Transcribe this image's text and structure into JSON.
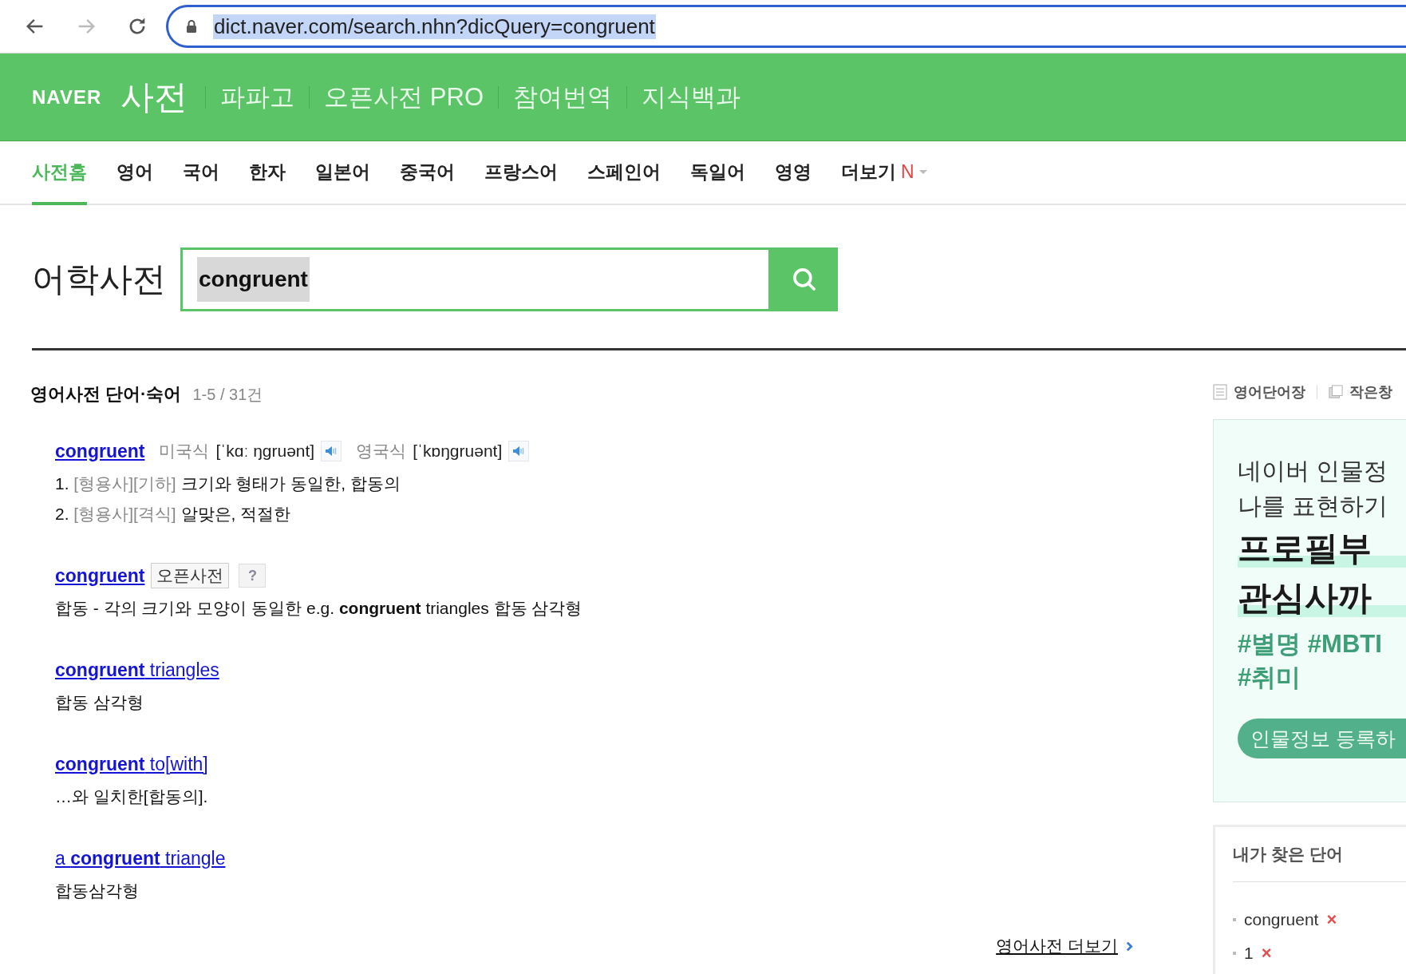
{
  "browser": {
    "url": "dict.naver.com/search.nhn?dicQuery=congruent",
    "forward_disabled": true
  },
  "header": {
    "logo": "NAVER",
    "title": "사전",
    "links": [
      "파파고",
      "오픈사전 PRO",
      "참여번역",
      "지식백과"
    ]
  },
  "tabs": [
    {
      "label": "사전홈",
      "selected": true
    },
    {
      "label": "영어",
      "selected": false
    },
    {
      "label": "국어",
      "selected": false
    },
    {
      "label": "한자",
      "selected": false
    },
    {
      "label": "일본어",
      "selected": false
    },
    {
      "label": "중국어",
      "selected": false
    },
    {
      "label": "프랑스어",
      "selected": false
    },
    {
      "label": "스페인어",
      "selected": false
    },
    {
      "label": "독일어",
      "selected": false
    },
    {
      "label": "영영",
      "selected": false
    },
    {
      "label": "더보기",
      "selected": false,
      "badge": "N"
    }
  ],
  "search": {
    "title": "어학사전",
    "value": "congruent"
  },
  "results": {
    "title": "영어사전 단어·숙어",
    "count": "1-5 / 31건",
    "entries": [
      {
        "kind": "pron",
        "headword": "congruent",
        "pronunciations": [
          {
            "label": "미국식",
            "ipa": "[ˈkɑː ŋgruənt]"
          },
          {
            "label": "영국식",
            "ipa": "[ˈkɒŋgruənt]"
          }
        ],
        "meanings": [
          {
            "number": "1.",
            "tags": "[형용사][기하]",
            "text": "크기와 형태가 동일한, 합동의"
          },
          {
            "number": "2.",
            "tags": "[형용사][격식]",
            "text": "알맞은, 적절한"
          }
        ]
      },
      {
        "kind": "open",
        "headword": "congruent",
        "tag": "오픈사전",
        "help": "?",
        "definition": "합동 - 각의 크기와 모양이 동일한 e.g. **congruent** triangles 합동 삼각형"
      },
      {
        "kind": "phrase",
        "headword": "congruent",
        "suffix": "triangles",
        "definition": "합동 삼각형"
      },
      {
        "kind": "phrase",
        "headword": "congruent",
        "suffix": "to[with]",
        "definition": "…와 일치한[합동의]."
      },
      {
        "kind": "phrase",
        "prefix": "a",
        "headword": "congruent",
        "suffix": "triangle",
        "definition": "합동삼각형"
      }
    ],
    "more": "영어사전 더보기"
  },
  "sidebar": {
    "tools": [
      "영어단어장",
      "작은창"
    ],
    "ad": {
      "lines": [
        "네이버 인물정",
        "나를 표현하기"
      ],
      "headline": [
        "프로필부",
        "관심사까"
      ],
      "hashtags": [
        "#별명 #MBTI",
        "#취미"
      ],
      "button": "인물정보 등록하"
    },
    "history": {
      "title": "내가 찾은 단어",
      "items": [
        "congruent",
        "1"
      ],
      "remove": "×"
    }
  }
}
